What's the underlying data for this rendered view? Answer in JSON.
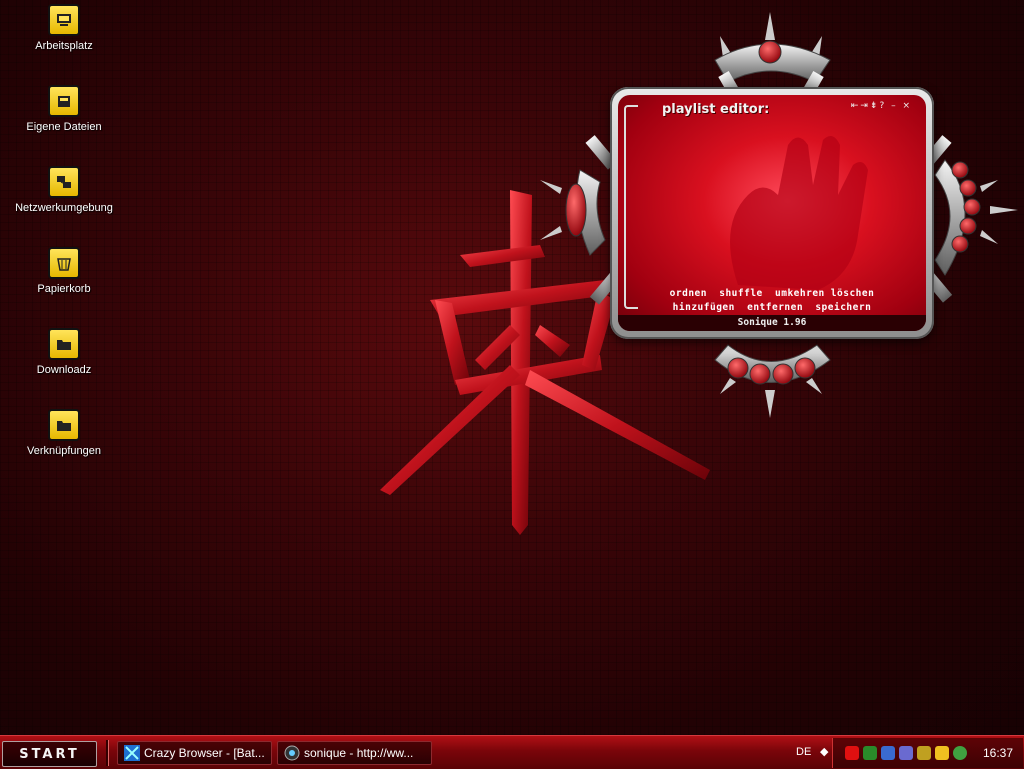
{
  "desktop": {
    "icons": [
      {
        "label": "Arbeitsplatz",
        "icon": "computer-icon"
      },
      {
        "label": "Eigene Dateien",
        "icon": "documents-icon"
      },
      {
        "label": "Netzwerkumgebung",
        "icon": "network-icon"
      },
      {
        "label": "Papierkorb",
        "icon": "recycle-bin-icon"
      },
      {
        "label": "Downloadz",
        "icon": "folder-icon"
      },
      {
        "label": "Verknüpfungen",
        "icon": "folder-icon"
      }
    ]
  },
  "player": {
    "title": "playlist editor:",
    "controls": "⇤⇥⇟? – ×",
    "actions_row1": [
      "ordnen",
      "shuffle",
      "umkehren",
      "löschen"
    ],
    "actions_row2": [
      "hinzufügen",
      "entfernen",
      "speichern"
    ],
    "version": "Sonique 1.96"
  },
  "taskbar": {
    "start_label": "START",
    "tasks": [
      {
        "label": "Crazy Browser - [Bat...",
        "icon": "crazy-browser-icon"
      },
      {
        "label": "sonique - http://ww...",
        "icon": "sonique-icon"
      }
    ],
    "language": "DE",
    "clock": "16:37"
  },
  "colors": {
    "accent": "#c0101c",
    "taskbar": "#7a050a",
    "desktop_bg": "#2a0305"
  }
}
